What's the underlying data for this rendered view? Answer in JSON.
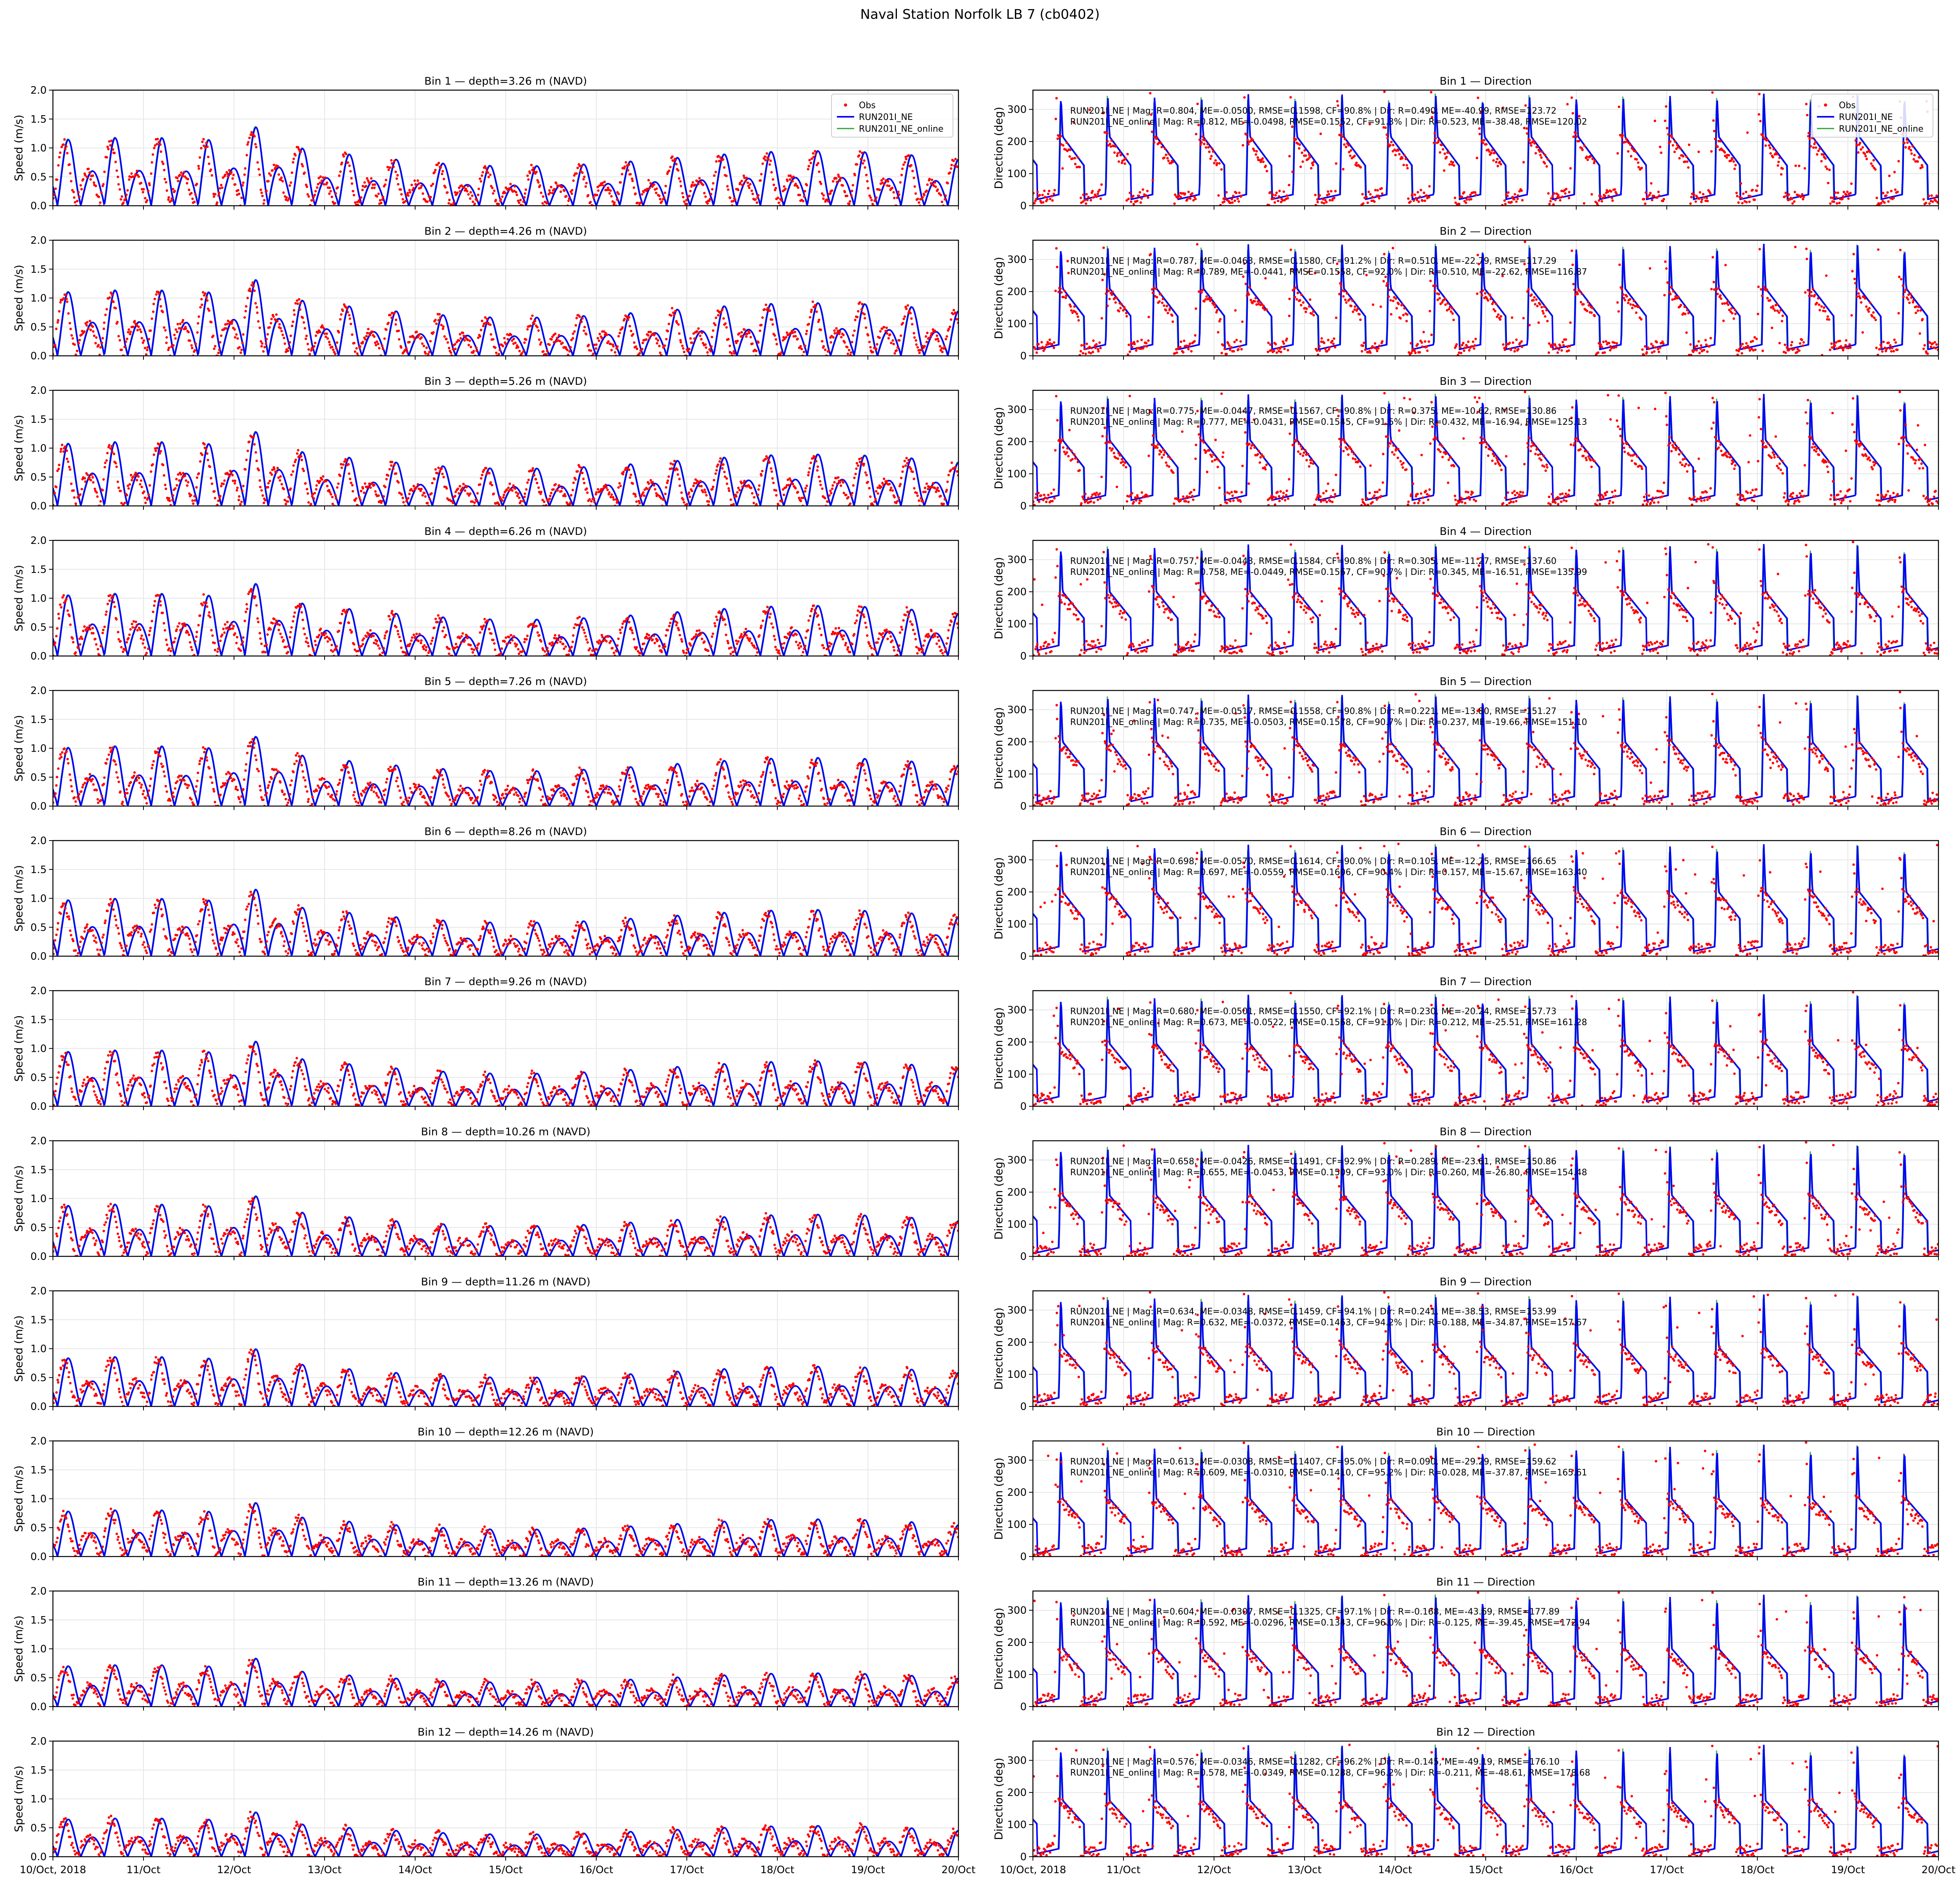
{
  "figure": {
    "suptitle": "Naval Station Norfolk LB 7 (cb0402)"
  },
  "colors": {
    "obs": "#ff0000",
    "run": "#0000ff",
    "online": "#2ca02c",
    "grid": "#e6e6e6",
    "axis": "#000000"
  },
  "chart_data": {
    "type": "line",
    "x_tick_labels": [
      "10/Oct, 2018",
      "11/Oct",
      "12/Oct",
      "13/Oct",
      "14/Oct",
      "15/Oct",
      "16/Oct",
      "17/Oct",
      "18/Oct",
      "19/Oct",
      "20/Oct"
    ],
    "xlim": [
      "2018-10-10",
      "2018-10-20"
    ],
    "speed_ylabel": "Speed (m/s)",
    "speed_ylim": [
      0,
      2.0
    ],
    "speed_yticks": [
      "0.0",
      "0.5",
      "1.0",
      "1.5",
      "2.0"
    ],
    "dir_ylabel": "Direction (deg)",
    "dir_ylim": [
      0,
      360
    ],
    "dir_yticks": [
      "0",
      "100",
      "200",
      "300"
    ],
    "legend": {
      "position": "upper-right",
      "entries": [
        "Obs",
        "RUN201I_NE",
        "RUN201I_NE_online"
      ]
    },
    "bins": [
      {
        "bin": 1,
        "speed_title": "Bin 1 — depth=3.26 m (NAVD)",
        "dir_title": "Bin 1 — Direction",
        "stats1": "RUN201I_NE | Mag: R=0.804, ME=-0.0500, RMSE=0.1598, CF=90.8% | Dir: R=0.490, ME=-40.99, RMSE=123.72",
        "stats2": "RUN201I_NE_online | Mag: R=0.812, ME=-0.0498, RMSE=0.1552, CF=91.3% | Dir: R=0.523, ME=-38.48, RMSE=120.02",
        "peak_speed": 0.85,
        "dir_low": 20,
        "dir_high": 215
      },
      {
        "bin": 2,
        "speed_title": "Bin 2 — depth=4.26 m (NAVD)",
        "dir_title": "Bin 2 — Direction",
        "stats1": "RUN201I_NE | Mag: R=0.787, ME=-0.0463, RMSE=0.1580, CF=91.2% | Dir: R=0.510, ME=-22.79, RMSE=117.29",
        "stats2": "RUN201I_NE_online | Mag: R=0.789, ME=-0.0441, RMSE=0.1558, CF=92.0% | Dir: R=0.510, ME=-22.62, RMSE=116.87",
        "peak_speed": 0.82,
        "dir_low": 20,
        "dir_high": 210
      },
      {
        "bin": 3,
        "speed_title": "Bin 3 — depth=5.26 m (NAVD)",
        "dir_title": "Bin 3 — Direction",
        "stats1": "RUN201I_NE | Mag: R=0.775, ME=-0.0447, RMSE=0.1567, CF=90.8% | Dir: R=0.375, ME=-10.62, RMSE=130.86",
        "stats2": "RUN201I_NE_online | Mag: R=0.777, ME=-0.0431, RMSE=0.1545, CF=91.5% | Dir: R=0.432, ME=-16.94, RMSE=125.13",
        "peak_speed": 0.8,
        "dir_low": 18,
        "dir_high": 205
      },
      {
        "bin": 4,
        "speed_title": "Bin 4 — depth=6.26 m (NAVD)",
        "dir_title": "Bin 4 — Direction",
        "stats1": "RUN201I_NE | Mag: R=0.757, ME=-0.0443, RMSE=0.1584, CF=90.8% | Dir: R=0.305, ME=-11.27, RMSE=137.60",
        "stats2": "RUN201I_NE_online | Mag: R=0.758, ME=-0.0449, RMSE=0.1567, CF=90.7% | Dir: R=0.345, ME=-16.51, RMSE=135.99",
        "peak_speed": 0.78,
        "dir_low": 18,
        "dir_high": 200
      },
      {
        "bin": 5,
        "speed_title": "Bin 5 — depth=7.26 m (NAVD)",
        "dir_title": "Bin 5 — Direction",
        "stats1": "RUN201I_NE | Mag: R=0.747, ME=-0.0517, RMSE=0.1558, CF=90.8% | Dir: R=0.221, ME=-13.80, RMSE=151.27",
        "stats2": "RUN201I_NE_online | Mag: R=0.735, ME=-0.0503, RMSE=0.1578, CF=90.7% | Dir: R=0.237, ME=-19.66, RMSE=151.10",
        "peak_speed": 0.75,
        "dir_low": 15,
        "dir_high": 200
      },
      {
        "bin": 6,
        "speed_title": "Bin 6 — depth=8.26 m (NAVD)",
        "dir_title": "Bin 6 — Direction",
        "stats1": "RUN201I_NE | Mag: R=0.698, ME=-0.0570, RMSE=0.1614, CF=90.0% | Dir: R=0.105, ME=-12.75, RMSE=166.65",
        "stats2": "RUN201I_NE_online | Mag: R=0.697, ME=-0.0559, RMSE=0.1606, CF=90.4% | Dir: R=0.157, ME=-15.67, RMSE=163.40",
        "peak_speed": 0.72,
        "dir_low": 15,
        "dir_high": 200
      },
      {
        "bin": 7,
        "speed_title": "Bin 7 — depth=9.26 m (NAVD)",
        "dir_title": "Bin 7 — Direction",
        "stats1": "RUN201I_NE | Mag: R=0.680, ME=-0.0501, RMSE=0.1550, CF=92.1% | Dir: R=0.230, ME=-20.24, RMSE=157.73",
        "stats2": "RUN201I_NE_online | Mag: R=0.673, ME=-0.0522, RMSE=0.1568, CF=91.0% | Dir: R=0.212, ME=-25.51, RMSE=161.28",
        "peak_speed": 0.7,
        "dir_low": 15,
        "dir_high": 195
      },
      {
        "bin": 8,
        "speed_title": "Bin 8 — depth=10.26 m (NAVD)",
        "dir_title": "Bin 8 — Direction",
        "stats1": "RUN201I_NE | Mag: R=0.658, ME=-0.0426, RMSE=0.1491, CF=92.9% | Dir: R=0.289, ME=-23.61, RMSE=150.86",
        "stats2": "RUN201I_NE_online | Mag: R=0.655, ME=-0.0453, RMSE=0.1509, CF=93.0% | Dir: R=0.260, ME=-26.80, RMSE=154.48",
        "peak_speed": 0.65,
        "dir_low": 12,
        "dir_high": 190
      },
      {
        "bin": 9,
        "speed_title": "Bin 9 — depth=11.26 m (NAVD)",
        "dir_title": "Bin 9 — Direction",
        "stats1": "RUN201I_NE | Mag: R=0.634, ME=-0.0348, RMSE=0.1459, CF=94.1% | Dir: R=0.241, ME=-38.53, RMSE=153.99",
        "stats2": "RUN201I_NE_online | Mag: R=0.632, ME=-0.0372, RMSE=0.1463, CF=94.2% | Dir: R=0.188, ME=-34.87, RMSE=157.67",
        "peak_speed": 0.62,
        "dir_low": 12,
        "dir_high": 185
      },
      {
        "bin": 10,
        "speed_title": "Bin 10 — depth=12.26 m (NAVD)",
        "dir_title": "Bin 10 — Direction",
        "stats1": "RUN201I_NE | Mag: R=0.613, ME=-0.0308, RMSE=0.1407, CF=95.0% | Dir: R=0.090, ME=-29.29, RMSE=159.62",
        "stats2": "RUN201I_NE_online | Mag: R=0.609, ME=-0.0310, RMSE=0.1410, CF=95.2% | Dir: R=0.028, ME=-37.87, RMSE=165.61",
        "peak_speed": 0.58,
        "dir_low": 10,
        "dir_high": 180
      },
      {
        "bin": 11,
        "speed_title": "Bin 11 — depth=13.26 m (NAVD)",
        "dir_title": "Bin 11 — Direction",
        "stats1": "RUN201I_NE | Mag: R=0.604, ME=-0.0307, RMSE=0.1325, CF=97.1% | Dir: R=-0.168, ME=-43.69, RMSE=177.89",
        "stats2": "RUN201I_NE_online | Mag: R=0.592, ME=-0.0296, RMSE=0.1343, CF=96.0% | Dir: R=-0.125, ME=-39.45, RMSE=172.94",
        "peak_speed": 0.52,
        "dir_low": 10,
        "dir_high": 180
      },
      {
        "bin": 12,
        "speed_title": "Bin 12 — depth=14.26 m (NAVD)",
        "dir_title": "Bin 12 — Direction",
        "stats1": "RUN201I_NE | Mag: R=0.576, ME=-0.0346, RMSE=0.1282, CF=96.2% | Dir: R=-0.145, ME=-49.19, RMSE=176.10",
        "stats2": "RUN201I_NE_online | Mag: R=0.578, ME=-0.0349, RMSE=0.1288, CF=96.2% | Dir: R=-0.211, ME=-48.61, RMSE=178.68",
        "peak_speed": 0.48,
        "dir_low": 10,
        "dir_high": 175
      }
    ]
  }
}
